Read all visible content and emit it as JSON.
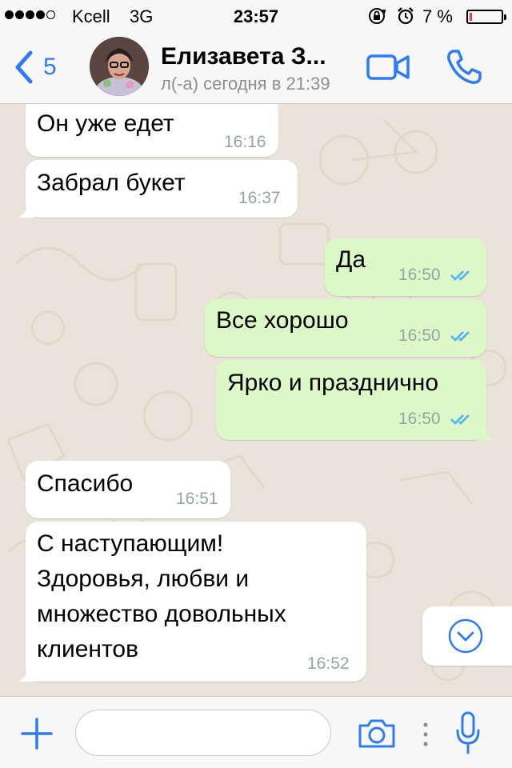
{
  "status_bar": {
    "carrier": "Kcell",
    "network": "3G",
    "time": "23:57",
    "battery_percent": "7 %",
    "battery_level": 0.07,
    "signal_bars_filled": 4,
    "signal_bars_total": 5,
    "icons": [
      "rotation-lock-icon",
      "alarm-icon",
      "battery-icon"
    ]
  },
  "header": {
    "back_count": "5",
    "contact_name": "Елизавета З...",
    "contact_status": "л(-а) сегодня в 21:39",
    "icons": [
      "back-chevron-icon",
      "video-call-icon",
      "phone-call-icon"
    ]
  },
  "messages": [
    {
      "direction": "in",
      "text": "Он уже едет",
      "time": "16:16"
    },
    {
      "direction": "in",
      "text": "Забрал букет",
      "time": "16:37"
    },
    {
      "direction": "out",
      "text": "Да",
      "time": "16:50",
      "status": "read"
    },
    {
      "direction": "out",
      "text": "Все хорошо",
      "time": "16:50",
      "status": "read"
    },
    {
      "direction": "out",
      "text": "Ярко и празднично",
      "time": "16:50",
      "status": "read"
    },
    {
      "direction": "in",
      "text": "Спасибо",
      "time": "16:51"
    },
    {
      "direction": "in",
      "lines": [
        "С наступающим!",
        "Здоровья, любви и",
        "множество довольных",
        "клиентов"
      ],
      "time": "16:52"
    }
  ],
  "input_bar": {
    "placeholder": "",
    "icons": [
      "plus-icon",
      "camera-icon",
      "more-dots-icon",
      "microphone-icon"
    ]
  },
  "colors": {
    "accent": "#2f7bf6",
    "chat_background": "#e9e3d9",
    "incoming_bubble": "#ffffff",
    "outgoing_bubble": "#dcf8c6",
    "read_ticks": "#4fb3f6",
    "battery_low": "#ff3b30"
  }
}
